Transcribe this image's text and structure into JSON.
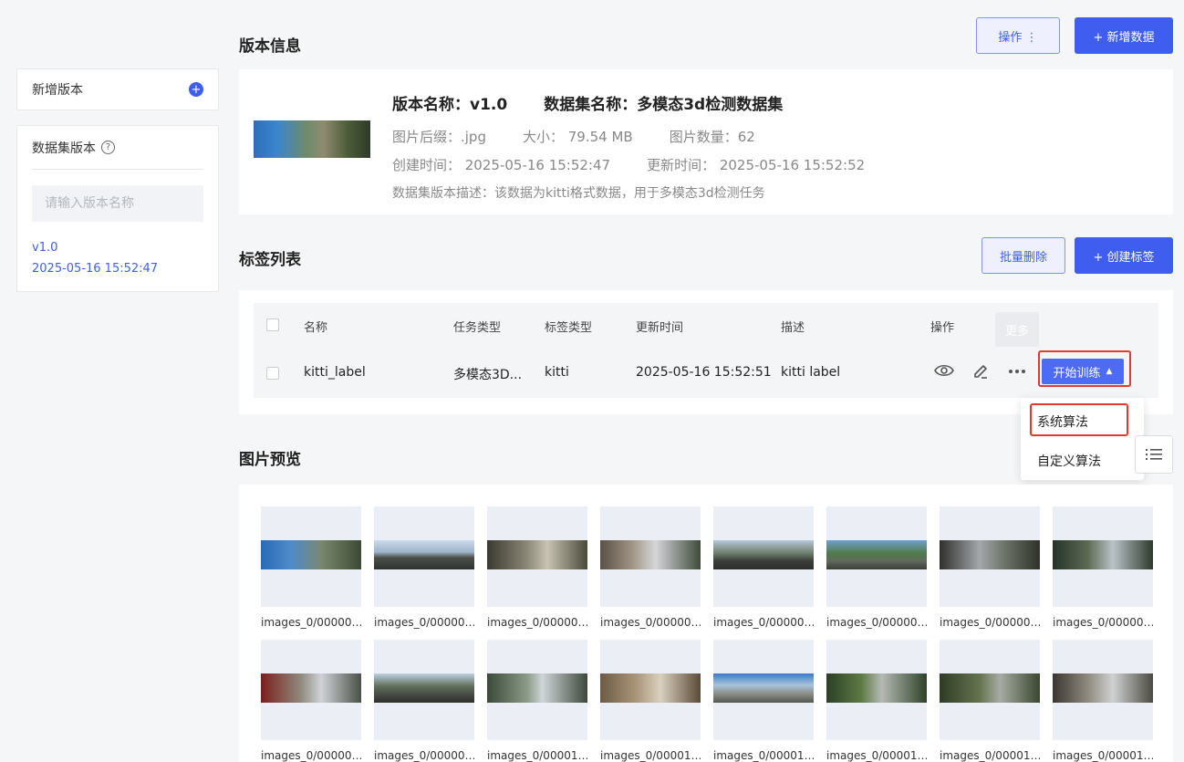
{
  "sidebar": {
    "add_version": "新增版本",
    "add_icon": "plus-circle-icon",
    "panel_title": "数据集版本",
    "search_placeholder": "请输入版本名称",
    "versions": [
      {
        "name": "v1.0",
        "date": "2025-05-16 15:52:47"
      }
    ]
  },
  "version_info": {
    "section_title": "版本信息",
    "actions_label": "操作 ⋮",
    "add_data_label": "+ 新增数据",
    "name": "版本名称：v1.0",
    "dataset_name": "数据集名称：多模态3d检测数据集",
    "suffix": "图片后缀：.jpg",
    "size": "大小： 79.54 MB",
    "count": "图片数量：62",
    "created": "创建时间： 2025-05-16 15:52:47",
    "updated": "更新时间： 2025-05-16 15:52:52",
    "description": "数据集版本描述：该数据为kitti格式数据，用于多模态3d检测任务"
  },
  "labels": {
    "section_title": "标签列表",
    "batch_delete_label": "批量删除",
    "create_label": "+ 创建标签",
    "columns": [
      "名称",
      "任务类型",
      "标签类型",
      "更新时间",
      "描述",
      "操作"
    ],
    "rows": [
      {
        "name": "kitti_label",
        "task_type": "多模态3D...",
        "label_type": "kitti",
        "updated": "2025-05-16 15:52:51",
        "description": "kitti label"
      }
    ],
    "tooltip": "更多",
    "train_button": "开始训练",
    "menu": [
      "系统算法",
      "自定义算法"
    ]
  },
  "preview": {
    "section_title": "图片预览",
    "images_row1": [
      "images_0/00000…",
      "images_0/00000…",
      "images_0/00000…",
      "images_0/00000…",
      "images_0/00000…",
      "images_0/00000…",
      "images_0/00000…",
      "images_0/00000…"
    ],
    "images_row2": [
      "images_0/00000…",
      "images_0/00000…",
      "images_0/00001…",
      "images_0/00001…",
      "images_0/00001…",
      "images_0/00001…",
      "images_0/00001…",
      "images_0/00001…"
    ]
  },
  "colors": {
    "accent": "#3f5ef0",
    "highlight_border": "#e23b2e"
  }
}
